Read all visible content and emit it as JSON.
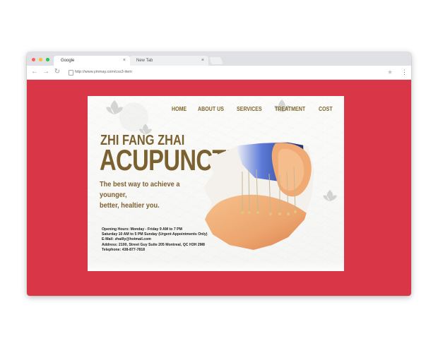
{
  "browser": {
    "tabs": [
      {
        "label": "Google",
        "close_label": "×"
      },
      {
        "label": "New Tab",
        "close_label": "×"
      }
    ],
    "toolbar": {
      "back_icon": "←",
      "forward_icon": "→",
      "refresh_icon": "↻",
      "address": "http://www.yinmay.com/css3-item",
      "star_icon": "★",
      "menu_icon": "⋮"
    },
    "colors": {
      "viewport_background": "#d93648",
      "tab_strip": "#dfe1e5"
    }
  },
  "site": {
    "nav": [
      "HOME",
      "ABOUT US",
      "SERVICES",
      "TREATMENT",
      "COST"
    ],
    "hero": {
      "title": "ZHI FANG ZHAI",
      "heading": "ACUPUNCTURE",
      "tagline": "The best way to achieve a younger,\nbetter, healtier you."
    },
    "info": [
      "Opening Hours: Monday - Friday 9 AM to 7 PM",
      "Saturday 10 AM to 5 PM  Sunday (Urgent Appointments Only)",
      "E-Mail:  zhailly@hotmail.com",
      "Address: 2100, Street Guy Suite 205 Montreal, QC  H3H  2M8",
      "Telephone: 438-877-7818"
    ],
    "colors": {
      "brand_brown": "#7c6130",
      "accent_orange": "#e79a55"
    }
  }
}
